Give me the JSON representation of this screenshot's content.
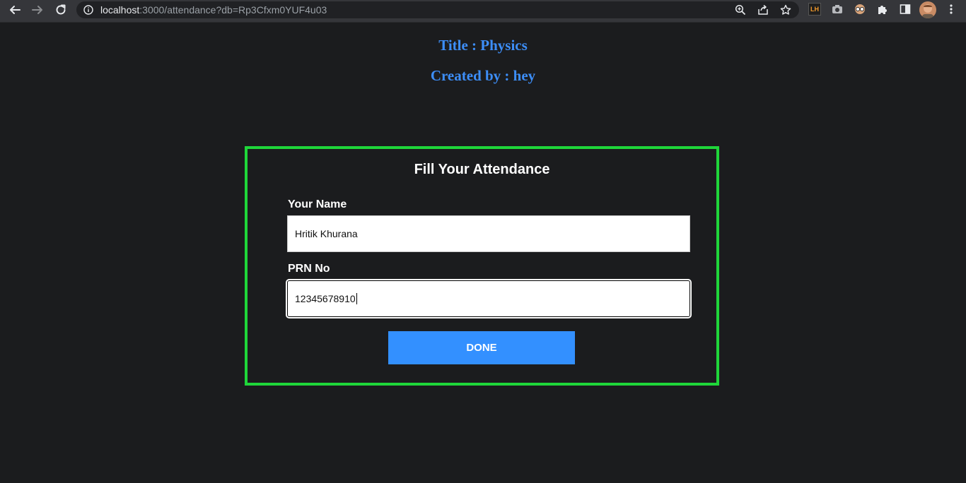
{
  "browser": {
    "url_host": "localhost",
    "url_path": ":3000/attendance?db=Rp3Cfxm0YUF4u03",
    "ext_lh_label": "LH"
  },
  "page": {
    "title_line": "Title : Physics",
    "created_line": "Created by : hey"
  },
  "form": {
    "heading": "Fill Your Attendance",
    "name_label": "Your Name",
    "name_value": "Hritik Khurana",
    "prn_label": "PRN No",
    "prn_value": "12345678910",
    "submit_label": "DONE"
  },
  "colors": {
    "accent_blue": "#3d8ef8",
    "border_green": "#1fd63a",
    "button_blue": "#3390ff",
    "background": "#1b1c1e"
  }
}
